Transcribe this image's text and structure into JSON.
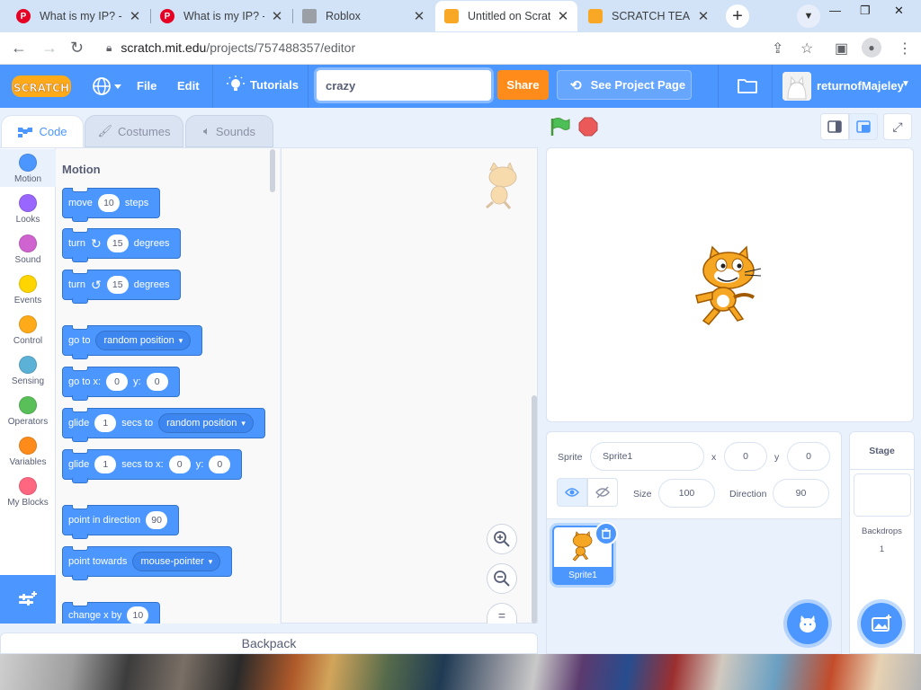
{
  "browser": {
    "tabs": [
      {
        "title": "What is my IP? - V",
        "icon": "pinterest-icon",
        "active": false
      },
      {
        "title": "What is my IP? - V",
        "icon": "pinterest-icon",
        "active": false
      },
      {
        "title": "Roblox",
        "icon": "roblox-icon",
        "active": false
      },
      {
        "title": "Untitled on Scratc",
        "icon": "scratch-icon",
        "active": true
      },
      {
        "title": "SCRATCH TEAM I",
        "icon": "scratch-icon",
        "active": false
      }
    ],
    "url_host": "scratch.mit.edu",
    "url_path": "/projects/757488357/editor"
  },
  "menubar": {
    "logo_text": "SCRATCH",
    "file": "File",
    "edit": "Edit",
    "tutorials": "Tutorials",
    "project_title": "crazy",
    "share": "Share",
    "see_project_page": "See Project Page",
    "username": "returnofMajeley"
  },
  "editor_tabs": {
    "code": "Code",
    "costumes": "Costumes",
    "sounds": "Sounds"
  },
  "categories": [
    {
      "name": "Motion",
      "color": "#4c97ff"
    },
    {
      "name": "Looks",
      "color": "#9966ff"
    },
    {
      "name": "Sound",
      "color": "#cf63cf"
    },
    {
      "name": "Events",
      "color": "#ffd500"
    },
    {
      "name": "Control",
      "color": "#ffab19"
    },
    {
      "name": "Sensing",
      "color": "#5cb1d6"
    },
    {
      "name": "Operators",
      "color": "#59c059"
    },
    {
      "name": "Variables",
      "color": "#ff8c1a"
    },
    {
      "name": "My Blocks",
      "color": "#ff6680"
    }
  ],
  "palette": {
    "heading": "Motion",
    "blocks": {
      "move": {
        "a": "move",
        "v": "10",
        "b": "steps"
      },
      "turn_cw": {
        "a": "turn",
        "v": "15",
        "b": "degrees"
      },
      "turn_ccw": {
        "a": "turn",
        "v": "15",
        "b": "degrees"
      },
      "goto": {
        "a": "go to",
        "dd": "random position"
      },
      "gotoxy": {
        "a": "go to x:",
        "x": "0",
        "b": "y:",
        "y": "0"
      },
      "glide_to": {
        "a": "glide",
        "v": "1",
        "b": "secs to",
        "dd": "random position"
      },
      "glide_xy": {
        "a": "glide",
        "v": "1",
        "b": "secs to x:",
        "x": "0",
        "c": "y:",
        "y": "0"
      },
      "point_dir": {
        "a": "point in direction",
        "v": "90"
      },
      "point_towards": {
        "a": "point towards",
        "dd": "mouse-pointer"
      },
      "change_x": {
        "a": "change x by",
        "v": "10"
      }
    }
  },
  "backpack": "Backpack",
  "sprite_info": {
    "sprite_label": "Sprite",
    "sprite_name": "Sprite1",
    "x_label": "x",
    "x": "0",
    "y_label": "y",
    "y": "0",
    "size_label": "Size",
    "size": "100",
    "direction_label": "Direction",
    "direction": "90"
  },
  "sprites": [
    {
      "name": "Sprite1"
    }
  ],
  "stage_panel": {
    "title": "Stage",
    "backdrops_label": "Backdrops",
    "backdrops_count": "1"
  }
}
